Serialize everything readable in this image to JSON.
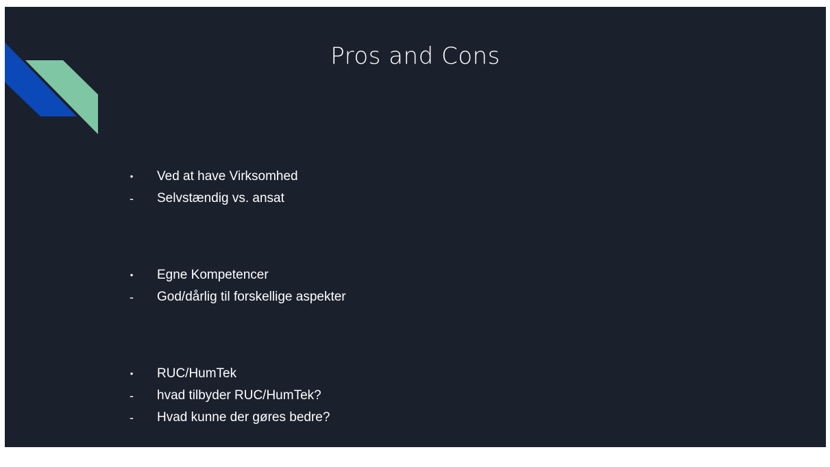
{
  "colors": {
    "background": "#1b202d",
    "text": "#ffffff",
    "accent_blue": "#0b49b8",
    "accent_green": "#7fc6a4"
  },
  "slide": {
    "title": "Pros and Cons",
    "groups": [
      {
        "items": [
          {
            "marker": "•",
            "type": "bullet",
            "text": "Ved at have Virksomhed"
          },
          {
            "marker": "-",
            "type": "dash",
            "text": "Selvstændig vs. ansat"
          }
        ]
      },
      {
        "items": [
          {
            "marker": "•",
            "type": "bullet",
            "text": "Egne Kompetencer"
          },
          {
            "marker": "-",
            "type": "dash",
            "text": "God/dårlig til forskellige aspekter"
          }
        ]
      },
      {
        "items": [
          {
            "marker": "•",
            "type": "bullet",
            "text": "RUC/HumTek"
          },
          {
            "marker": "-",
            "type": "dash",
            "text": "hvad tilbyder RUC/HumTek?"
          },
          {
            "marker": "-",
            "type": "dash",
            "text": "Hvad kunne der gøres bedre?"
          }
        ]
      }
    ]
  }
}
